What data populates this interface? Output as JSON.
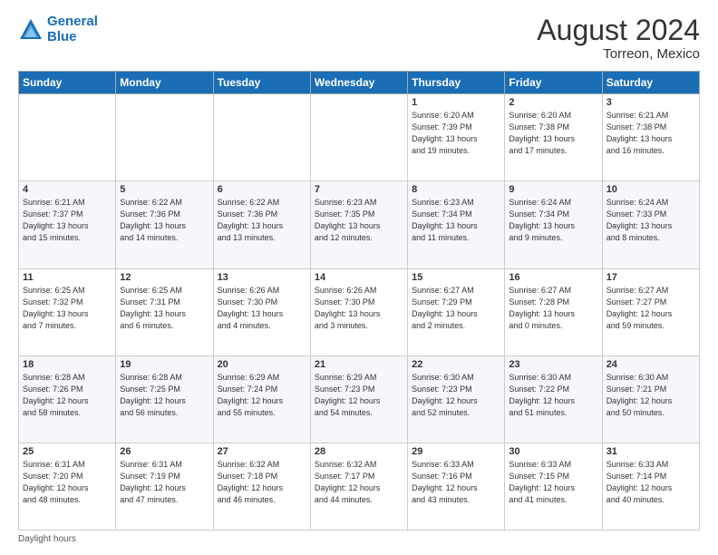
{
  "header": {
    "logo_line1": "General",
    "logo_line2": "Blue",
    "month_year": "August 2024",
    "location": "Torreon, Mexico"
  },
  "days_of_week": [
    "Sunday",
    "Monday",
    "Tuesday",
    "Wednesday",
    "Thursday",
    "Friday",
    "Saturday"
  ],
  "weeks": [
    [
      {
        "day": "",
        "info": ""
      },
      {
        "day": "",
        "info": ""
      },
      {
        "day": "",
        "info": ""
      },
      {
        "day": "",
        "info": ""
      },
      {
        "day": "1",
        "info": "Sunrise: 6:20 AM\nSunset: 7:39 PM\nDaylight: 13 hours\nand 19 minutes."
      },
      {
        "day": "2",
        "info": "Sunrise: 6:20 AM\nSunset: 7:38 PM\nDaylight: 13 hours\nand 17 minutes."
      },
      {
        "day": "3",
        "info": "Sunrise: 6:21 AM\nSunset: 7:38 PM\nDaylight: 13 hours\nand 16 minutes."
      }
    ],
    [
      {
        "day": "4",
        "info": "Sunrise: 6:21 AM\nSunset: 7:37 PM\nDaylight: 13 hours\nand 15 minutes."
      },
      {
        "day": "5",
        "info": "Sunrise: 6:22 AM\nSunset: 7:36 PM\nDaylight: 13 hours\nand 14 minutes."
      },
      {
        "day": "6",
        "info": "Sunrise: 6:22 AM\nSunset: 7:36 PM\nDaylight: 13 hours\nand 13 minutes."
      },
      {
        "day": "7",
        "info": "Sunrise: 6:23 AM\nSunset: 7:35 PM\nDaylight: 13 hours\nand 12 minutes."
      },
      {
        "day": "8",
        "info": "Sunrise: 6:23 AM\nSunset: 7:34 PM\nDaylight: 13 hours\nand 11 minutes."
      },
      {
        "day": "9",
        "info": "Sunrise: 6:24 AM\nSunset: 7:34 PM\nDaylight: 13 hours\nand 9 minutes."
      },
      {
        "day": "10",
        "info": "Sunrise: 6:24 AM\nSunset: 7:33 PM\nDaylight: 13 hours\nand 8 minutes."
      }
    ],
    [
      {
        "day": "11",
        "info": "Sunrise: 6:25 AM\nSunset: 7:32 PM\nDaylight: 13 hours\nand 7 minutes."
      },
      {
        "day": "12",
        "info": "Sunrise: 6:25 AM\nSunset: 7:31 PM\nDaylight: 13 hours\nand 6 minutes."
      },
      {
        "day": "13",
        "info": "Sunrise: 6:26 AM\nSunset: 7:30 PM\nDaylight: 13 hours\nand 4 minutes."
      },
      {
        "day": "14",
        "info": "Sunrise: 6:26 AM\nSunset: 7:30 PM\nDaylight: 13 hours\nand 3 minutes."
      },
      {
        "day": "15",
        "info": "Sunrise: 6:27 AM\nSunset: 7:29 PM\nDaylight: 13 hours\nand 2 minutes."
      },
      {
        "day": "16",
        "info": "Sunrise: 6:27 AM\nSunset: 7:28 PM\nDaylight: 13 hours\nand 0 minutes."
      },
      {
        "day": "17",
        "info": "Sunrise: 6:27 AM\nSunset: 7:27 PM\nDaylight: 12 hours\nand 59 minutes."
      }
    ],
    [
      {
        "day": "18",
        "info": "Sunrise: 6:28 AM\nSunset: 7:26 PM\nDaylight: 12 hours\nand 58 minutes."
      },
      {
        "day": "19",
        "info": "Sunrise: 6:28 AM\nSunset: 7:25 PM\nDaylight: 12 hours\nand 56 minutes."
      },
      {
        "day": "20",
        "info": "Sunrise: 6:29 AM\nSunset: 7:24 PM\nDaylight: 12 hours\nand 55 minutes."
      },
      {
        "day": "21",
        "info": "Sunrise: 6:29 AM\nSunset: 7:23 PM\nDaylight: 12 hours\nand 54 minutes."
      },
      {
        "day": "22",
        "info": "Sunrise: 6:30 AM\nSunset: 7:23 PM\nDaylight: 12 hours\nand 52 minutes."
      },
      {
        "day": "23",
        "info": "Sunrise: 6:30 AM\nSunset: 7:22 PM\nDaylight: 12 hours\nand 51 minutes."
      },
      {
        "day": "24",
        "info": "Sunrise: 6:30 AM\nSunset: 7:21 PM\nDaylight: 12 hours\nand 50 minutes."
      }
    ],
    [
      {
        "day": "25",
        "info": "Sunrise: 6:31 AM\nSunset: 7:20 PM\nDaylight: 12 hours\nand 48 minutes."
      },
      {
        "day": "26",
        "info": "Sunrise: 6:31 AM\nSunset: 7:19 PM\nDaylight: 12 hours\nand 47 minutes."
      },
      {
        "day": "27",
        "info": "Sunrise: 6:32 AM\nSunset: 7:18 PM\nDaylight: 12 hours\nand 46 minutes."
      },
      {
        "day": "28",
        "info": "Sunrise: 6:32 AM\nSunset: 7:17 PM\nDaylight: 12 hours\nand 44 minutes."
      },
      {
        "day": "29",
        "info": "Sunrise: 6:33 AM\nSunset: 7:16 PM\nDaylight: 12 hours\nand 43 minutes."
      },
      {
        "day": "30",
        "info": "Sunrise: 6:33 AM\nSunset: 7:15 PM\nDaylight: 12 hours\nand 41 minutes."
      },
      {
        "day": "31",
        "info": "Sunrise: 6:33 AM\nSunset: 7:14 PM\nDaylight: 12 hours\nand 40 minutes."
      }
    ]
  ],
  "footer": {
    "note": "Daylight hours"
  }
}
